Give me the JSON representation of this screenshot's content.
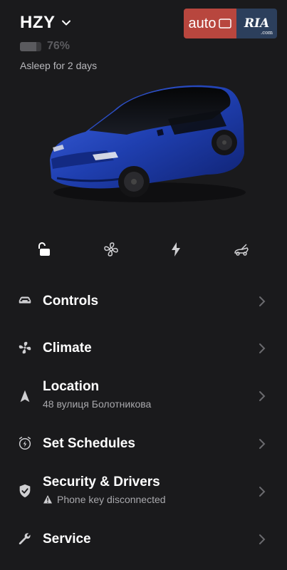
{
  "vehicle": {
    "name": "HZY",
    "battery_percent_text": "76%",
    "battery_level": 0.76,
    "status": "Asleep for 2 days"
  },
  "watermark": {
    "auto_text": "auto",
    "ria_text": "RIA",
    "ria_suffix": ".com"
  },
  "quick_actions": [
    {
      "icon": "unlock-icon"
    },
    {
      "icon": "fan-icon"
    },
    {
      "icon": "charge-bolt-icon"
    },
    {
      "icon": "frunk-icon"
    }
  ],
  "menu": {
    "controls": {
      "label": "Controls"
    },
    "climate": {
      "label": "Climate"
    },
    "location": {
      "label": "Location",
      "sub": "48 вулиця Болотникова"
    },
    "schedules": {
      "label": "Set Schedules"
    },
    "security": {
      "label": "Security & Drivers",
      "sub": "Phone key disconnected"
    },
    "service": {
      "label": "Service"
    }
  },
  "colors": {
    "background": "#1a1a1c",
    "car_body": "#1f3fb0",
    "text_secondary": "#b8b8bc",
    "chevron": "#6a6a6e"
  }
}
